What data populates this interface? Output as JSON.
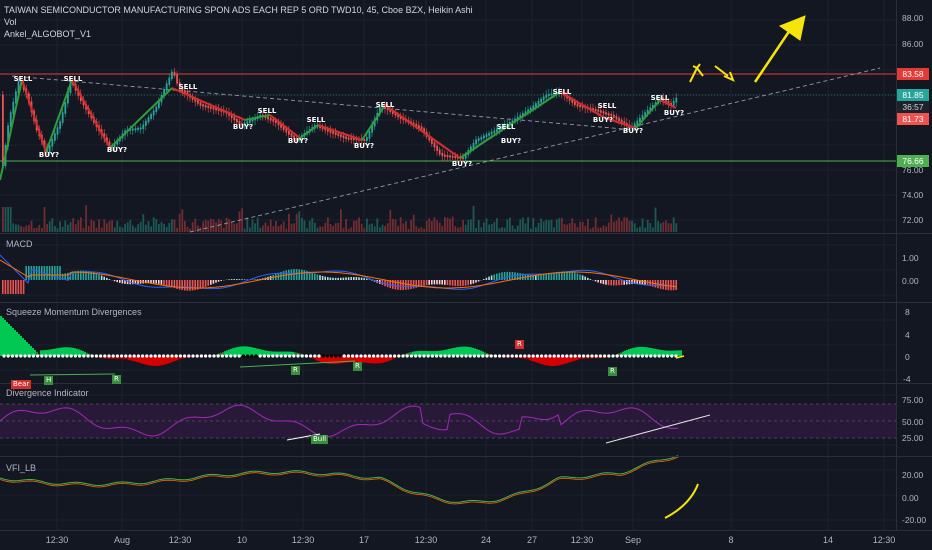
{
  "header": {
    "title": "TAIWAN SEMICONDUCTOR MANUFACTURING SPON ADS EACH REP 5 ORD TWD10, 45, Cboe BZX, Heikin Ashi",
    "line2": "Vol",
    "line3": "Ankel_ALGOBOT_V1"
  },
  "panes": {
    "macd": "MACD",
    "squeeze": "Squeeze Momentum Divergences",
    "divergence": "Divergence Indicator",
    "vfi": "VFI_LB"
  },
  "price_axis": [
    "88.00",
    "86.00",
    "76.00",
    "74.00",
    "72.00"
  ],
  "price_boxes": {
    "resistance": "83.58",
    "last": "81.85",
    "countdown": "36:57",
    "current": "81.73",
    "support": "76.66"
  },
  "macd_axis": [
    "1.00",
    "0.00"
  ],
  "squeeze_axis": [
    "8",
    "4",
    "0",
    "-4"
  ],
  "div_axis": [
    "75.00",
    "50.00",
    "25.00"
  ],
  "vfi_axis": [
    "20.00",
    "0.00",
    "-20.00"
  ],
  "x_axis": [
    "12:30",
    "Aug",
    "12:30",
    "10",
    "12:30",
    "17",
    "12:30",
    "24",
    "27",
    "12:30",
    "Sep",
    "8",
    "14",
    "12:30"
  ],
  "signals": {
    "sell": "SELL",
    "buy": "BUY?"
  },
  "tags": {
    "h": "H",
    "r": "R",
    "bear": "Bear",
    "bull": "Bull"
  },
  "colors": {
    "background": "#131722",
    "up": "#26a69a",
    "down": "#ef5350",
    "resistance": "#e53935",
    "support": "#4caf50",
    "annotation": "#f5e50a",
    "rsi": "#9c27b0"
  }
}
